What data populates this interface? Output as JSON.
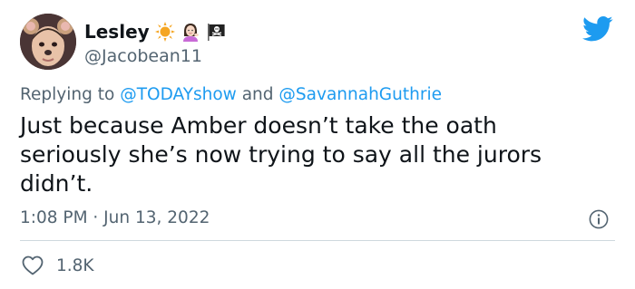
{
  "user": {
    "display_name": "Lesley",
    "handle": "@Jacobean11",
    "badge_icons": [
      "sun-emoji-icon",
      "woman-tipping-hand-emoji-icon",
      "pirate-flag-emoji-icon"
    ]
  },
  "reply_context": {
    "prefix": "Replying to",
    "mention_1": "@TODAYshow",
    "joiner": "and",
    "mention_2": "@SavannahGuthrie"
  },
  "tweet": {
    "text": "Just because Amber doesn’t take the oath seriously she’s now trying to say all the jurors didn’t.",
    "timestamp": "1:08 PM · Jun 13, 2022"
  },
  "engagement": {
    "likes": "1.8K"
  },
  "colors": {
    "accent": "#1d9bf0",
    "text_primary": "#0f1419",
    "text_secondary": "#536471",
    "divider": "#cfd9de"
  }
}
